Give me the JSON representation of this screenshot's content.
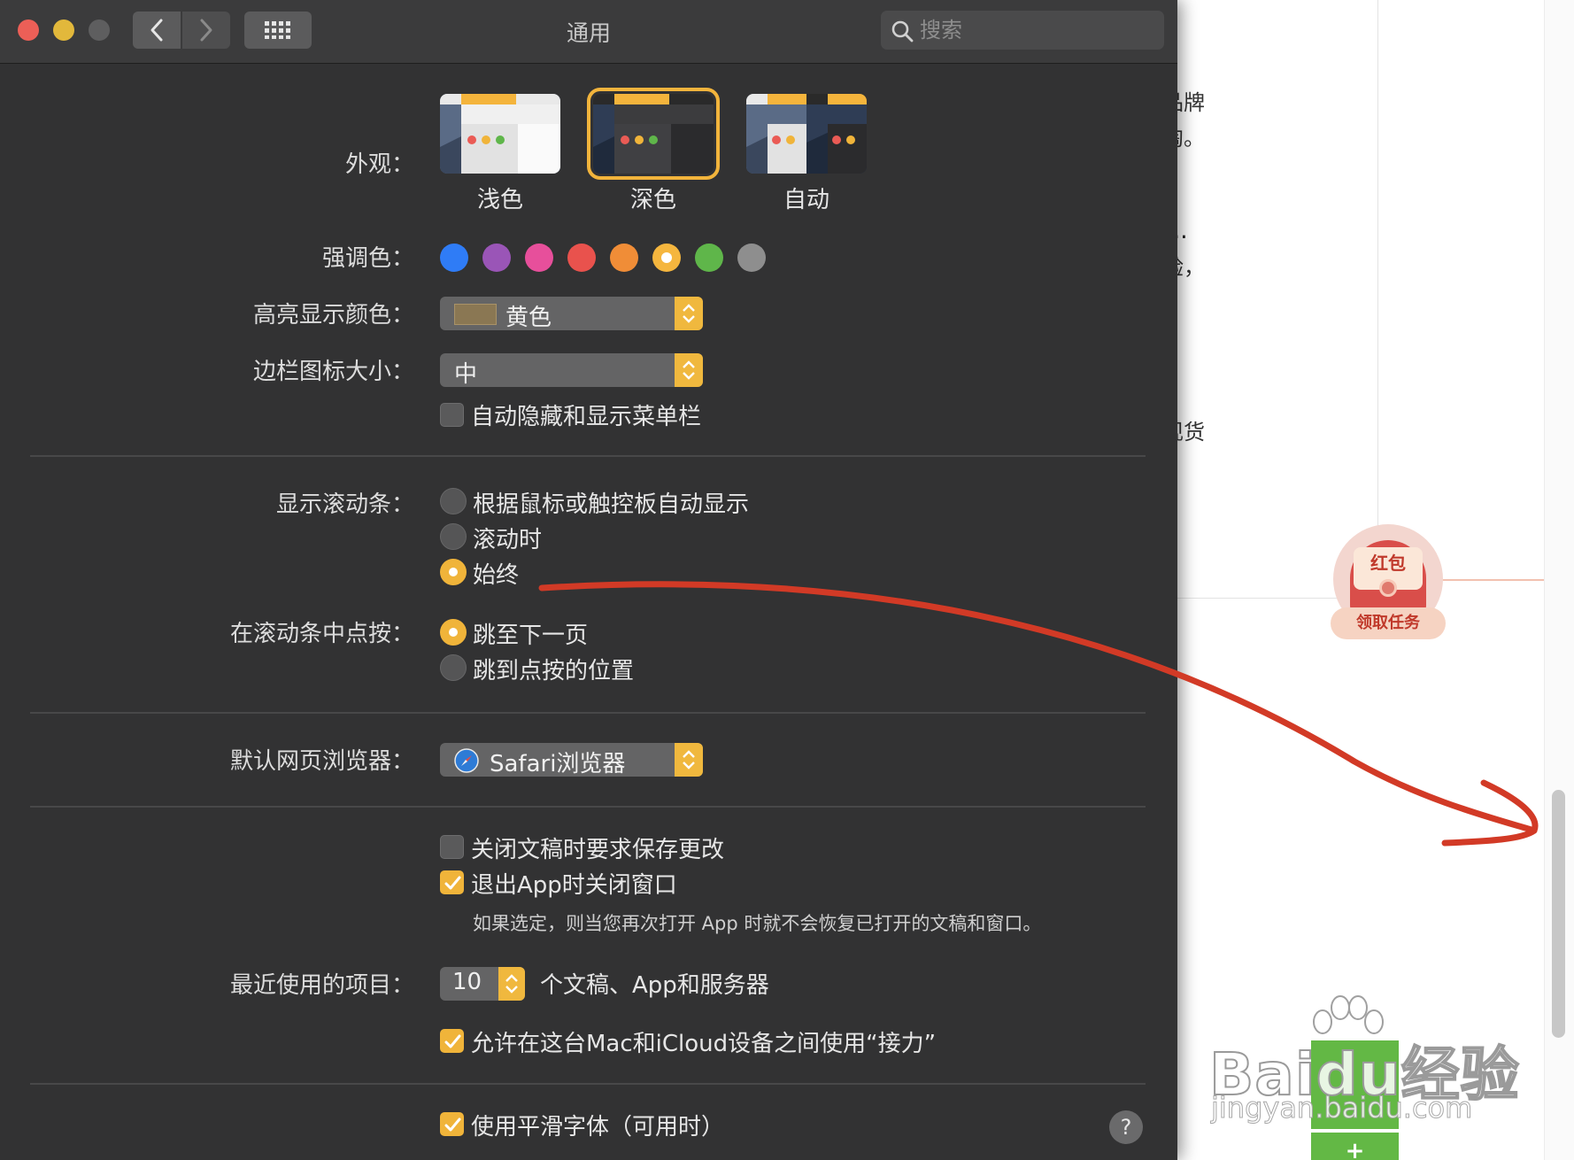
{
  "window": {
    "title": "通用",
    "search_placeholder": "搜索"
  },
  "appearance": {
    "label": "外观：",
    "options": [
      {
        "label": "浅色",
        "selected": false
      },
      {
        "label": "深色",
        "selected": true
      },
      {
        "label": "自动",
        "selected": false
      }
    ]
  },
  "accent": {
    "label": "强调色：",
    "colors": [
      "#2f7cf6",
      "#9a55b7",
      "#e74f9b",
      "#e9524d",
      "#f08d37",
      "#f5b63e",
      "#5fb64a",
      "#8e8e8e"
    ],
    "selected_index": 5
  },
  "highlight": {
    "label": "高亮显示颜色：",
    "value": "黄色"
  },
  "sidebar_icon_size": {
    "label": "边栏图标大小：",
    "value": "中"
  },
  "auto_hide_menubar": {
    "label": "自动隐藏和显示菜单栏",
    "checked": false
  },
  "show_scrollbars": {
    "label": "显示滚动条：",
    "options": [
      {
        "label": "根据鼠标或触控板自动显示",
        "checked": false
      },
      {
        "label": "滚动时",
        "checked": false
      },
      {
        "label": "始终",
        "checked": true
      }
    ]
  },
  "click_scrollbar": {
    "label": "在滚动条中点按：",
    "options": [
      {
        "label": "跳至下一页",
        "checked": true
      },
      {
        "label": "跳到点按的位置",
        "checked": false
      }
    ]
  },
  "default_browser": {
    "label": "默认网页浏览器：",
    "value": "Safari浏览器"
  },
  "ask_save_changes": {
    "label": "关闭文稿时要求保存更改",
    "checked": false
  },
  "close_windows_on_quit": {
    "label": "退出App时关闭窗口",
    "checked": true,
    "hint": "如果选定，则当您再次打开 App 时就不会恢复已打开的文稿和窗口。"
  },
  "recent_items": {
    "label": "最近使用的项目：",
    "value": "10",
    "suffix": "个文稿、App和服务器"
  },
  "handoff": {
    "label": "允许在这台Mac和iCloud设备之间使用“接力”",
    "checked": true
  },
  "font_smoothing": {
    "label": "使用平滑字体（可用时）",
    "checked": true
  },
  "help_label": "?",
  "background_page": {
    "lines": [
      "多品牌",
      "就淘。",
      "的...",
      "体验，",
      "量现货"
    ],
    "hongbao_title": "红包",
    "hongbao_task": "领取任务",
    "watermark_main": "Baidu经验",
    "watermark_sub": "jingyan.baidu.com",
    "plus": "+"
  }
}
